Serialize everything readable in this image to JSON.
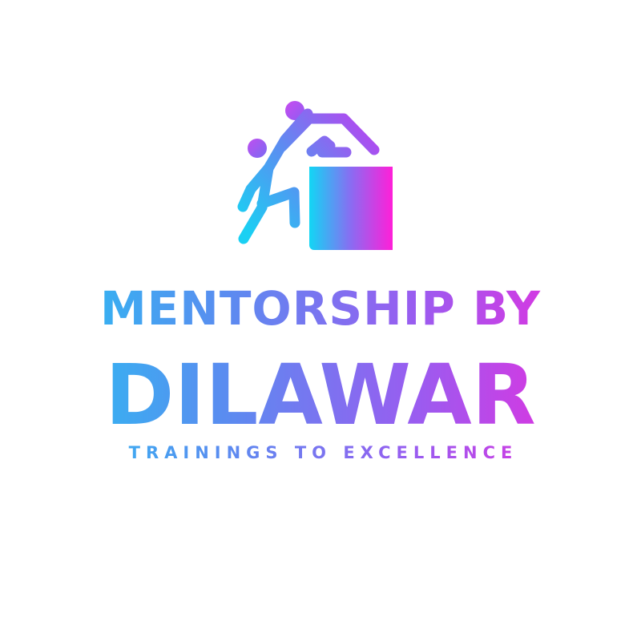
{
  "logo": {
    "icon": "climber-helping-climber-box-icon",
    "title_line_1": "MENTORSHIP BY",
    "title_line_2": "DILAWAR",
    "tagline": "TRAININGS TO EXCELLENCE"
  },
  "colors": {
    "gradient_start": "#1ecbf2",
    "gradient_mid_1": "#5a8cf0",
    "gradient_mid_2": "#9a5cf0",
    "gradient_end": "#ff1fd8",
    "background": "#ffffff"
  }
}
